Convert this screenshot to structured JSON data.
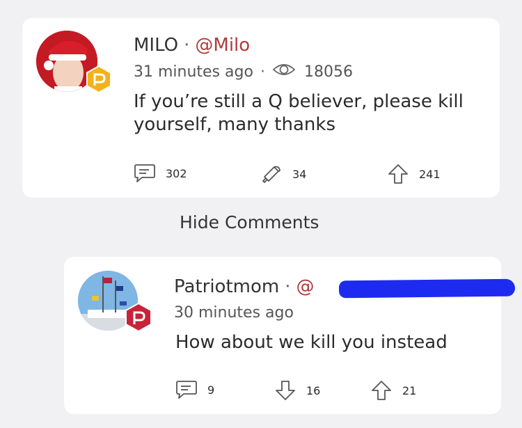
{
  "post": {
    "author_name": "MILO",
    "handle": "@Milo",
    "time_ago": "31 minutes ago",
    "views": "18056",
    "body": "If you’re still a Q believer, please kill yourself, many thanks",
    "comments_count": "302",
    "echoes_count": "34",
    "upvotes_count": "241"
  },
  "hide_comments_label": "Hide Comments",
  "comment": {
    "author_name": "Patriotmom",
    "handle_visible": "@",
    "time_ago": "30 minutes ago",
    "body": "How about we kill you instead",
    "comments_count": "9",
    "downvotes_count": "16",
    "upvotes_count": "21"
  },
  "colors": {
    "page_background": "#f1f1f3",
    "card_background": "#ffffff",
    "handle_color": "#b03a3a",
    "redaction_marker": "#1d2bf0",
    "badge_gold": "#f2b21c",
    "badge_red": "#c8233a"
  },
  "icons": {
    "comment": "speech-bubble-icon",
    "echo": "megaphone-icon",
    "upvote": "arrow-up-icon",
    "downvote": "arrow-down-icon",
    "views": "eye-icon",
    "badge": "parler-badge-icon"
  }
}
